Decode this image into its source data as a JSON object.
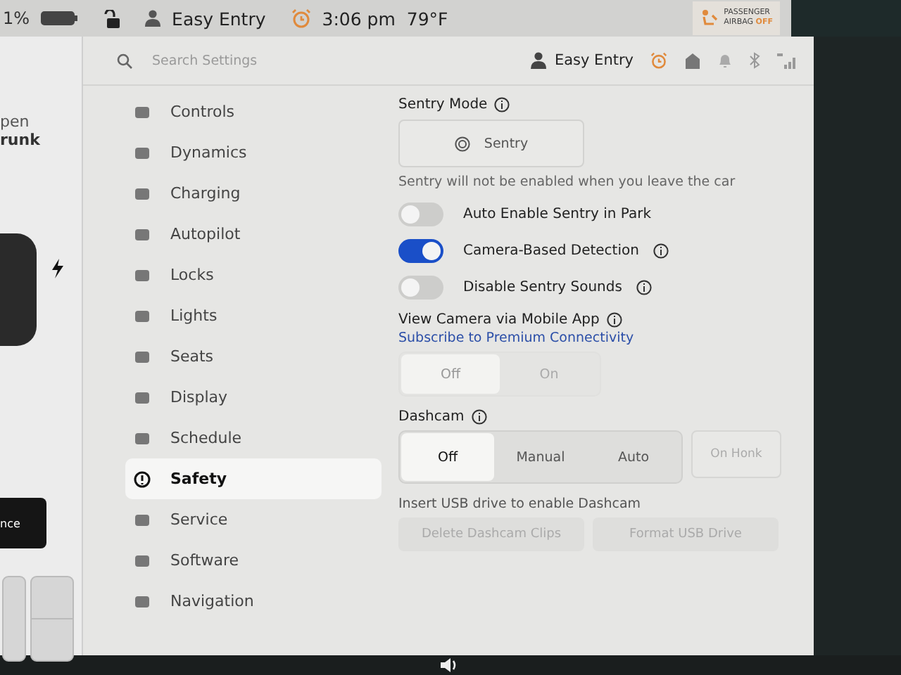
{
  "status_bar": {
    "battery": "1%",
    "profile": "Easy Entry",
    "time": "3:06 pm",
    "temperature": "79°F",
    "airbag_badge": {
      "line_1": "PASSENGER",
      "line_2": "AIRBAG",
      "state": "OFF"
    }
  },
  "left_panel": {
    "trunk_label": [
      "pen",
      "runk"
    ],
    "button": "nce"
  },
  "header": {
    "search": {
      "placeholder": "Search Settings"
    },
    "profile": "Easy Entry"
  },
  "sidebar": {
    "items": [
      {
        "label": "Controls",
        "selected": false
      },
      {
        "label": "Dynamics",
        "selected": false
      },
      {
        "label": "Charging",
        "selected": false
      },
      {
        "label": "Autopilot",
        "selected": false
      },
      {
        "label": "Locks",
        "selected": false
      },
      {
        "label": "Lights",
        "selected": false
      },
      {
        "label": "Seats",
        "selected": false
      },
      {
        "label": "Display",
        "selected": false
      },
      {
        "label": "Schedule",
        "selected": false
      },
      {
        "label": "Safety",
        "selected": true
      },
      {
        "label": "Service",
        "selected": false
      },
      {
        "label": "Software",
        "selected": false
      },
      {
        "label": "Navigation",
        "selected": false
      }
    ]
  },
  "sentry_mode": {
    "title": "Sentry Mode",
    "button": "Sentry",
    "note": "Sentry will not be enabled when you leave the car"
  },
  "toggles": [
    {
      "label": "Auto Enable Sentry in Park",
      "on": false,
      "info": false
    },
    {
      "label": "Camera-Based Detection",
      "on": true,
      "info": true
    },
    {
      "label": "Disable Sentry Sounds",
      "on": false,
      "info": true
    }
  ],
  "view_camera": {
    "title": "View Camera via Mobile App",
    "link": "Subscribe to Premium Connectivity",
    "disabled": true,
    "options": [
      {
        "label": "Off",
        "selected": true
      },
      {
        "label": "On",
        "selected": false
      }
    ]
  },
  "dashcam": {
    "title": "Dashcam",
    "options": [
      {
        "label": "Off",
        "selected": true
      },
      {
        "label": "Manual",
        "selected": false
      },
      {
        "label": "Auto",
        "selected": false
      }
    ],
    "extra_option": {
      "label": "On Honk",
      "disabled": true
    },
    "note": "Insert USB drive to enable Dashcam",
    "buttons": [
      {
        "label": "Delete Dashcam Clips",
        "disabled": true
      },
      {
        "label": "Format USB Drive",
        "disabled": true
      }
    ]
  }
}
